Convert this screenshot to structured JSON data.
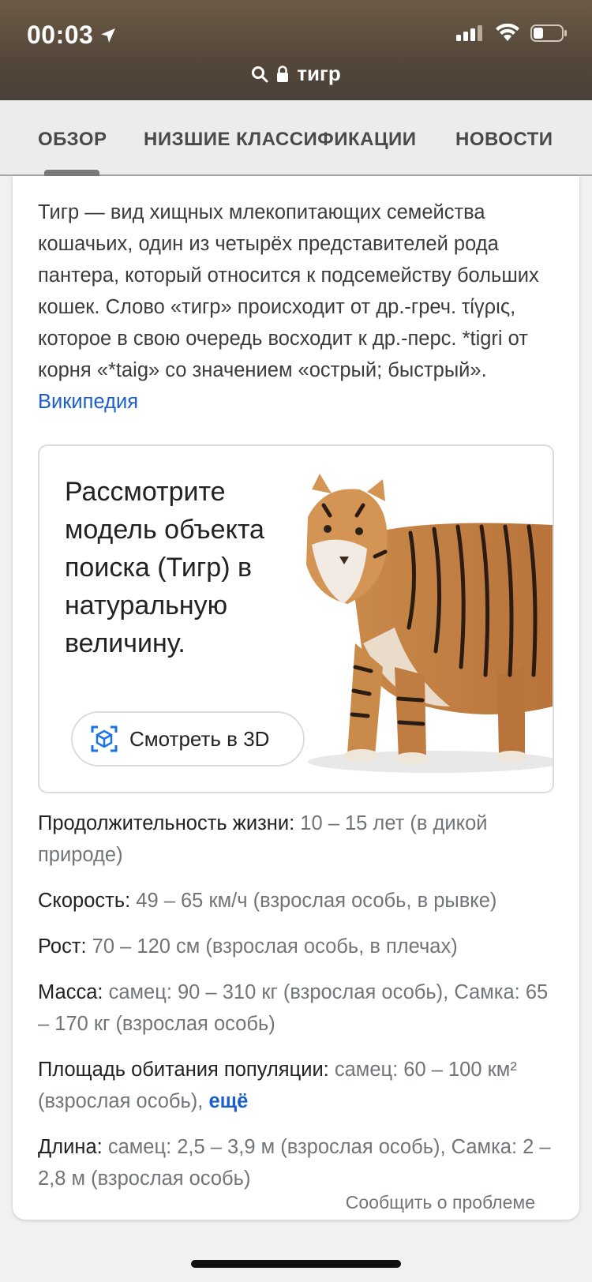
{
  "status_bar": {
    "time": "00:03"
  },
  "url_bar": {
    "query": "тигр"
  },
  "tabs": [
    {
      "label": "ОБЗОР"
    },
    {
      "label": "НИЗШИЕ КЛАССИФИКАЦИИ"
    },
    {
      "label": "НОВОСТИ"
    }
  ],
  "description": {
    "text": "Тигр — вид хищных млекопитающих семейства кошачьих, один из четырёх представителей рода пантера, который относится к подсемейству больших кошек. Слово «тигр» происходит от др.-греч. τίγρις, которое в свою очередь восходит к др.-перс. *tigri от корня «*taig» со значением «острый; быстрый».",
    "source_link": "Википедия"
  },
  "viewer3d": {
    "prompt": "Рассмотрите модель объекта поиска (Тигр) в натуральную величину.",
    "button_label": "Смотреть в 3D"
  },
  "facts": [
    {
      "label": "Продолжительность жизни:",
      "value": " 10 – 15 лет (в дикой природе)"
    },
    {
      "label": "Скорость:",
      "value": " 49 – 65 км/ч (взрослая особь, в рывке)"
    },
    {
      "label": "Рост:",
      "value": " 70 – 120 см (взрослая особь, в плечах)"
    },
    {
      "label": "Масса:",
      "value": " самец: 90 – 310 кг (взрослая особь), Самка: 65 – 170 кг (взрослая особь)"
    },
    {
      "label": "Площадь обитания популяции:",
      "value": " самец: 60 – 100 км² (взрослая особь), ",
      "more": "ещё"
    },
    {
      "label": "Длина:",
      "value": " самец: 2,5 – 3,9 м (взрослая особь), Самка: 2 – 2,8 м (взрослая особь)"
    }
  ],
  "footer": {
    "report_link": "Сообщить о проблеме"
  },
  "colors": {
    "link": "#1a5dd1",
    "secondary_text": "#70757a"
  }
}
